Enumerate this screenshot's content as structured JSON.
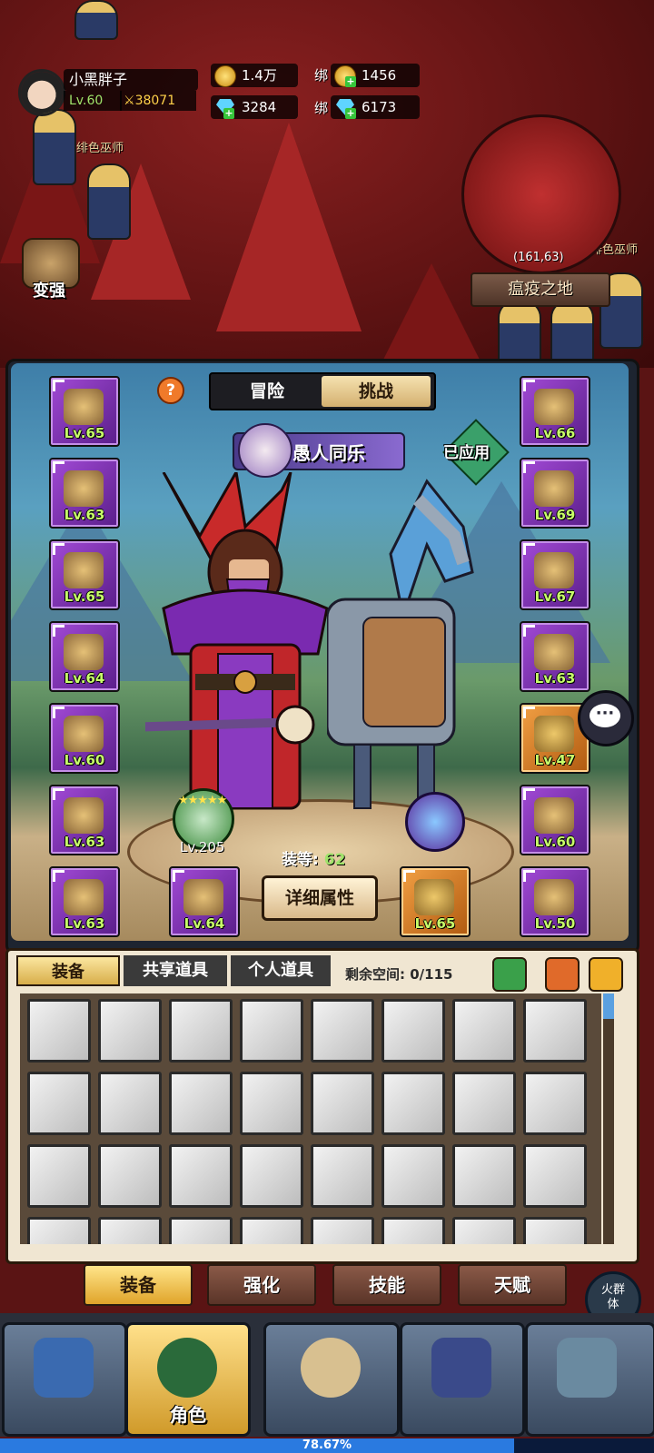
{
  "player": {
    "name": "小黑胖子",
    "level": "Lv.60",
    "power": "38071"
  },
  "resources": {
    "gold": "1.4万",
    "diamond": "3284",
    "bound_label": "绑",
    "bound_gold": "1456",
    "bound_diamond": "6173"
  },
  "world": {
    "npc_name_1": "绯色巫师",
    "npc_name_2": "绯色巫师",
    "coords": "(161,63)",
    "zone": "瘟疫之地",
    "strengthen_label": "变强"
  },
  "panel": {
    "tabs": [
      "冒险",
      "挑战"
    ],
    "active_tab": "挑战",
    "help_symbol": "?",
    "title": "愚人同乐",
    "applied_label": "已应用",
    "mount_level": "Lv.205",
    "mount_stars": "★★★★★",
    "equip_score_label": "装等:",
    "equip_score_value": "62",
    "detail_button": "详细属性",
    "left_slots": [
      "Lv.65",
      "Lv.63",
      "Lv.65",
      "Lv.64",
      "Lv.60",
      "Lv.63",
      "Lv.63"
    ],
    "right_slots": [
      "Lv.66",
      "Lv.69",
      "Lv.67",
      "Lv.63",
      "Lv.47",
      "Lv.60",
      "Lv.50"
    ],
    "bottom_slots": [
      "Lv.64",
      "Lv.65"
    ],
    "chat_icon": "···"
  },
  "inventory": {
    "tabs": [
      "装备",
      "共享道具",
      "个人道具"
    ],
    "active_tab": "装备",
    "space_label": "剩余空间: 0/115"
  },
  "sub_tabs": [
    "装备",
    "强化",
    "技能",
    "天赋"
  ],
  "active_sub_tab": "装备",
  "campfire_label": "火群体",
  "bottom_nav": {
    "active_label": "角色",
    "progress_text": "78.67%",
    "progress_value": 0.7867
  },
  "colors": {
    "accent_gold": "#ffd24a",
    "level_green": "#c8ff6a",
    "epic_purple": "#a24ad6",
    "legend_orange": "#f2a044"
  }
}
